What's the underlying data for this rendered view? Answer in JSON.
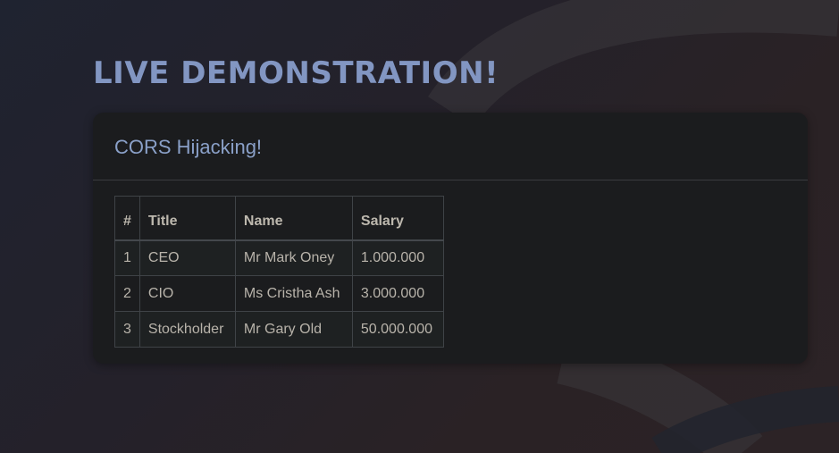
{
  "page": {
    "title": "LIVE DEMONSTRATION!"
  },
  "panel": {
    "title": "CORS Hijacking!"
  },
  "table": {
    "headers": [
      "#",
      "Title",
      "Name",
      "Salary"
    ],
    "rows": [
      [
        "1",
        "CEO",
        "Mr Mark Oney",
        "1.000.000"
      ],
      [
        "2",
        "CIO",
        "Ms Cristha Ash",
        "3.000.000"
      ],
      [
        "3",
        "Stockholder",
        "Mr Gary Old",
        "50.000.000"
      ]
    ]
  },
  "colors": {
    "heading": "#8296c2",
    "panel_title": "#8aa0c8",
    "panel_bg": "#1b1c1e",
    "table_text": "#b8b3aa"
  }
}
